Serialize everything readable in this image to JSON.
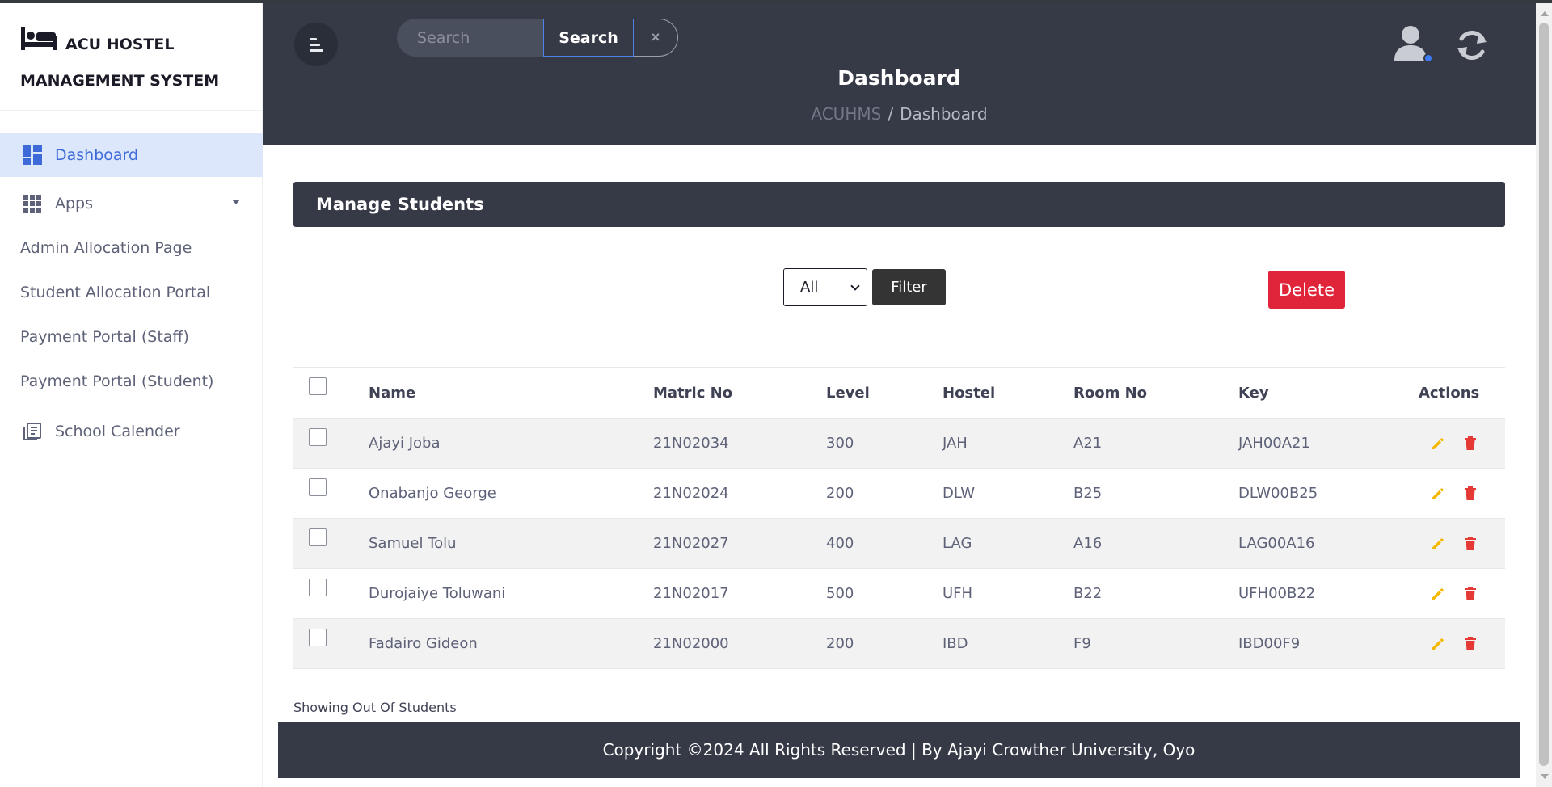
{
  "sidebar": {
    "brand_title": "ACU HOSTEL MANAGEMENT SYSTEM",
    "items": [
      {
        "label": "Dashboard",
        "icon": "dashboard-icon",
        "active": true
      },
      {
        "label": "Apps",
        "icon": "apps-grid-icon",
        "expandable": true
      }
    ],
    "links": [
      {
        "label": "Admin Allocation Page"
      },
      {
        "label": "Student Allocation Portal"
      },
      {
        "label": "Payment Portal (Staff)"
      },
      {
        "label": "Payment Portal (Student)"
      }
    ],
    "calendar": {
      "label": "School Calender",
      "icon": "calendar-book-icon"
    }
  },
  "header": {
    "search_placeholder": "Search",
    "search_button": "Search",
    "clear_button": "×",
    "title": "Dashboard",
    "breadcrumb_root": "ACUHMS",
    "breadcrumb_sep": "/",
    "breadcrumb_current": "Dashboard"
  },
  "card": {
    "title": "Manage Students",
    "filter_selected": "All",
    "filter_button": "Filter",
    "delete_button": "Delete"
  },
  "table": {
    "columns": {
      "name": "Name",
      "matric": "Matric No",
      "level": "Level",
      "hostel": "Hostel",
      "room": "Room No",
      "key": "Key",
      "actions": "Actions"
    },
    "rows": [
      {
        "name": "Ajayi Joba",
        "matric": "21N02034",
        "level": "300",
        "hostel": "JAH",
        "room": "A21",
        "key": "JAH00A21"
      },
      {
        "name": "Onabanjo George",
        "matric": "21N02024",
        "level": "200",
        "hostel": "DLW",
        "room": "B25",
        "key": "DLW00B25"
      },
      {
        "name": "Samuel Tolu",
        "matric": "21N02027",
        "level": "400",
        "hostel": "LAG",
        "room": "A16",
        "key": "LAG00A16"
      },
      {
        "name": "Durojaiye Toluwani",
        "matric": "21N02017",
        "level": "500",
        "hostel": "UFH",
        "room": "B22",
        "key": "UFH00B22"
      },
      {
        "name": "Fadairo Gideon",
        "matric": "21N02000",
        "level": "200",
        "hostel": "IBD",
        "room": "F9",
        "key": "IBD00F9"
      }
    ]
  },
  "showing_text": "Showing Out Of Students",
  "footer": {
    "text": "Copyright ©2024 All Rights Reserved | By Ajayi Crowther University, Oyo"
  },
  "colors": {
    "header_bg": "#363a47",
    "accent": "#3c6ad8",
    "delete": "#e0253a",
    "edit_icon": "#f5b800",
    "trash_icon": "#e53935"
  }
}
